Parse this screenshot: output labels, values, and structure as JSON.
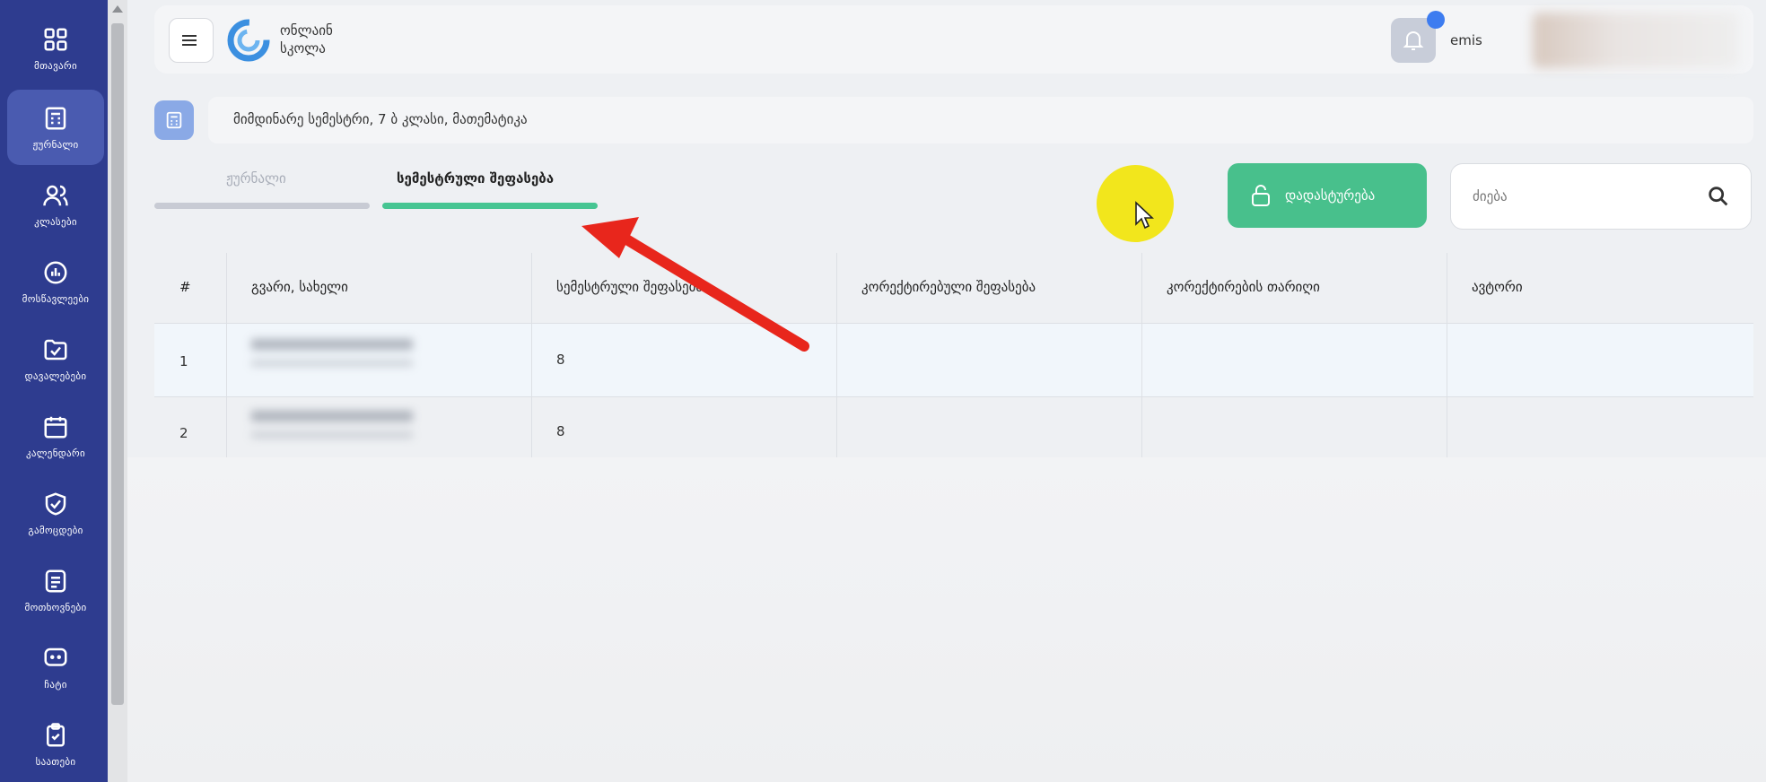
{
  "sidebar": {
    "items": [
      {
        "label": "მთავარი",
        "icon": "grid-icon"
      },
      {
        "label": "ჟურნალი",
        "icon": "journal-icon"
      },
      {
        "label": "კლასები",
        "icon": "users-icon"
      },
      {
        "label": "მოსწავლეები",
        "icon": "chart-icon"
      },
      {
        "label": "დავალებები",
        "icon": "folder-check-icon"
      },
      {
        "label": "კალენდარი",
        "icon": "calendar-icon"
      },
      {
        "label": "გამოცდები",
        "icon": "shield-check-icon"
      },
      {
        "label": "მოთხოვნები",
        "icon": "document-icon"
      },
      {
        "label": "ჩატი",
        "icon": "chat-icon"
      },
      {
        "label": "საათები",
        "icon": "clipboard-icon"
      }
    ]
  },
  "header": {
    "logo_text": "ონლაინ\nსკოლა",
    "user_name": "emis"
  },
  "breadcrumb": {
    "text": "მიმდინარე სემესტრი, 7 ბ კლასი, მათემატიკა"
  },
  "tabs": [
    {
      "label": "ჟურნალი",
      "active": false
    },
    {
      "label": "სემესტრული შეფასება",
      "active": true
    }
  ],
  "toolbar": {
    "confirm_label": "დადასტურება",
    "search_placeholder": "ძიება"
  },
  "table": {
    "headers": [
      "#",
      "გვარი, სახელი",
      "სემესტრული შეფასება",
      "კორექტირებული შეფასება",
      "კორექტირების თარიღი",
      "ავტორი"
    ],
    "rows": [
      {
        "index": "1",
        "grade": "8"
      },
      {
        "index": "2",
        "grade": "8"
      }
    ]
  },
  "colors": {
    "sidebar": "#2e3c8f",
    "accent": "#46c592",
    "notification": "#3d7cf0",
    "annotation_arrow": "#e8261c"
  }
}
